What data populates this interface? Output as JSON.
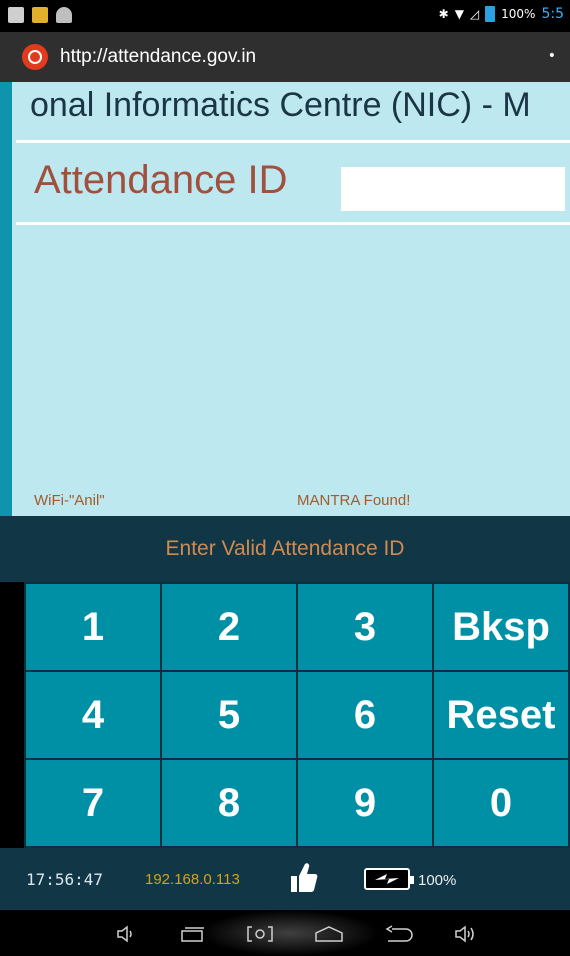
{
  "status_bar": {
    "battery_percent": "100%",
    "time": "5:5"
  },
  "browser": {
    "url": "http://attendance.gov.in",
    "menu_glyph": "•"
  },
  "content": {
    "marquee": "onal Informatics Centre (NIC) - M",
    "attendance_label": "Attendance ID",
    "attendance_value": "",
    "wifi_status": "WiFi-\"Anil\"",
    "device_status": "MANTRA Found!"
  },
  "message": "Enter Valid Attendance ID",
  "keypad": {
    "keys": [
      "1",
      "2",
      "3",
      "Bksp",
      "4",
      "5",
      "6",
      "Reset",
      "7",
      "8",
      "9",
      "0"
    ]
  },
  "info_bar": {
    "clock": "17:56:47",
    "ip": "192.168.0.113",
    "battery_percent": "100%"
  },
  "navigation": {
    "icons": [
      "volume-down-icon",
      "recent-apps-icon",
      "screenshot-icon",
      "home-icon",
      "back-icon",
      "volume-up-icon"
    ]
  },
  "colors": {
    "accent_teal": "#0090a6",
    "content_bg": "#bde8ef",
    "label_color": "#a1503e",
    "message_color": "#d08a52"
  }
}
